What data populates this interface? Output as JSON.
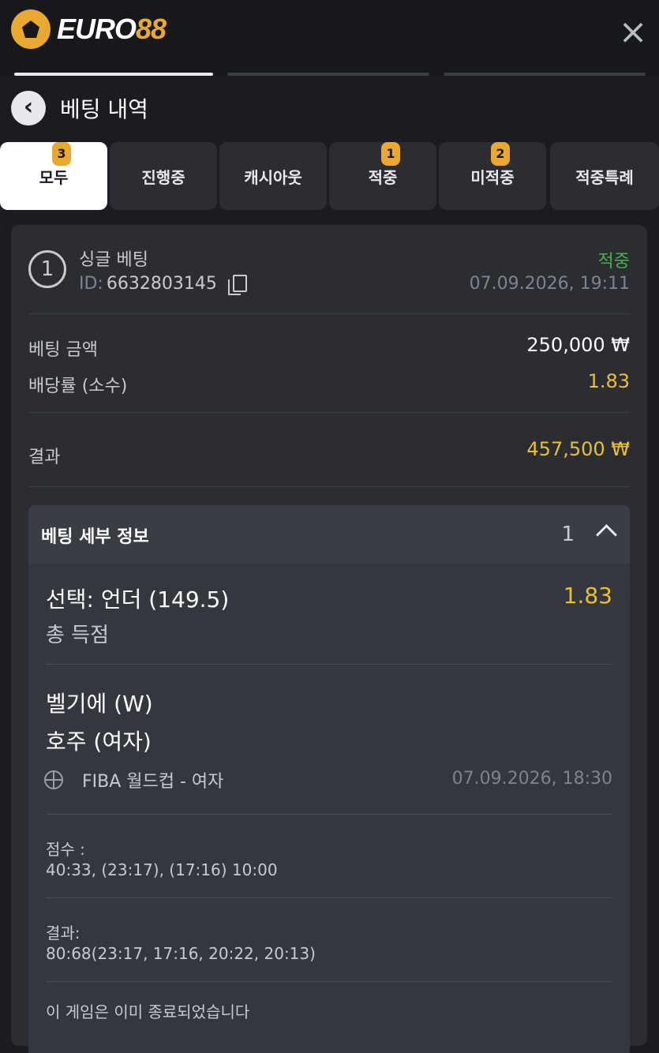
{
  "header": {
    "brand_euro": "EURO",
    "brand_88": "88",
    "close_glyph": "×"
  },
  "page": {
    "back_glyph": "‹",
    "title": "베팅 내역"
  },
  "filter_tabs": [
    {
      "label": "모두",
      "badge": "3",
      "active": true
    },
    {
      "label": "진행중",
      "badge": ""
    },
    {
      "label": "캐시아웃",
      "badge": ""
    },
    {
      "label": "적중",
      "badge": "1"
    },
    {
      "label": "미적중",
      "badge": "2"
    },
    {
      "label": "적중특례",
      "badge": ""
    }
  ],
  "bet": {
    "number": "1",
    "type": "싱글 베팅",
    "id_label": "ID:",
    "id": "6632803145",
    "status": "적중",
    "datetime": "07.09.2026, 19:11",
    "stake_label": "베팅 금액",
    "stake": "250,000 ₩",
    "odds_label": "배당률 (소수)",
    "odds": "1.83",
    "result_label": "결과",
    "result": "457,500 ₩"
  },
  "details": {
    "title": "베팅 세부 정보",
    "count": "1",
    "selection": "선택: 언더 (149.5)",
    "selection_odds": "1.83",
    "market": "총 득점",
    "team1": "벨기에 (W)",
    "team2": "호주 (여자)",
    "league": "FIBA 월드컵 - 여자",
    "match_datetime": "07.09.2026, 18:30",
    "score_label": "점수 :",
    "score": "40:33, (23:17), (17:16) 10:00",
    "final_label": "결과:",
    "final": "80:68(23:17, 17:16, 20:22, 20:13)",
    "note": "이 게임은 이미 종료되었습니다"
  },
  "colors": {
    "accent": "#e9a930",
    "win": "#47b34f",
    "odds": "#e9c12f"
  }
}
